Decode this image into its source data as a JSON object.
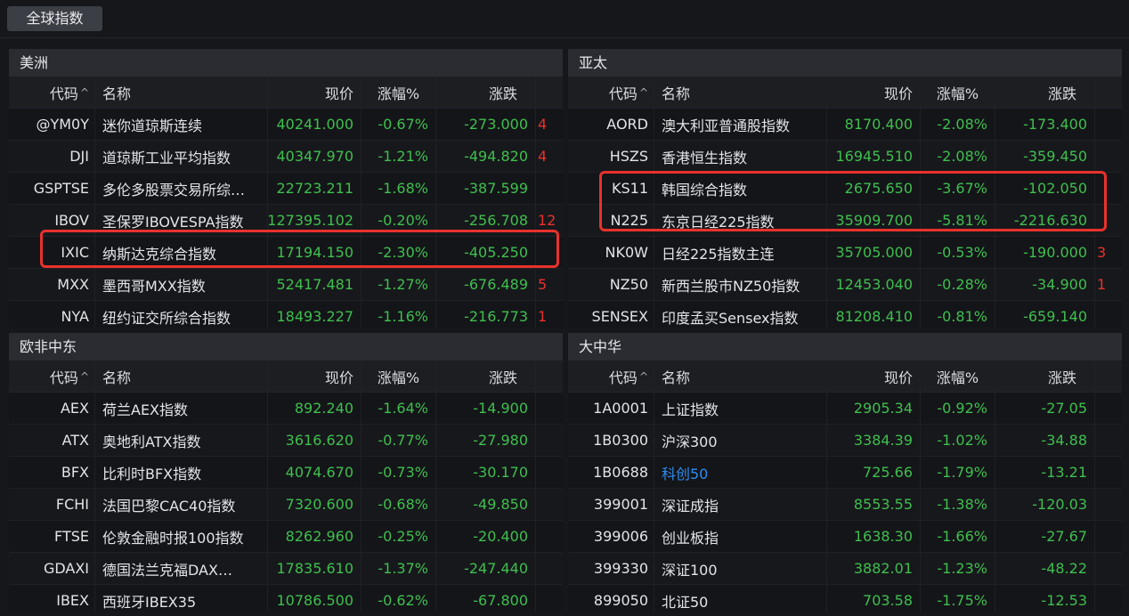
{
  "header": {
    "tab_label": "全球指数"
  },
  "columns": {
    "code": "代码",
    "name": "名称",
    "price": "现价",
    "pct": "涨幅%",
    "change": "涨跌",
    "sort_icon": "chevron-up-icon"
  },
  "colors": {
    "green": "#3fbf4e",
    "red": "#e8322c",
    "blue": "#2d8cf0"
  },
  "panels": {
    "americas": {
      "title": "美洲",
      "rows": [
        {
          "code": "@YM0Y",
          "name": "迷你道琼斯连续",
          "price": "40241.000",
          "pct": "-0.67%",
          "change": "-273.000",
          "extra": "4"
        },
        {
          "code": "DJI",
          "name": "道琼斯工业平均指数",
          "price": "40347.970",
          "pct": "-1.21%",
          "change": "-494.820",
          "extra": "4"
        },
        {
          "code": "GSPTSE",
          "name": "多伦多股票交易所综…",
          "price": "22723.211",
          "pct": "-1.68%",
          "change": "-387.599",
          "extra": ""
        },
        {
          "code": "IBOV",
          "name": "圣保罗IBOVESPA指数",
          "price": "127395.102",
          "pct": "-0.20%",
          "change": "-256.708",
          "extra": "12"
        },
        {
          "code": "IXIC",
          "name": "纳斯达克综合指数",
          "price": "17194.150",
          "pct": "-2.30%",
          "change": "-405.250",
          "extra": ""
        },
        {
          "code": "MXX",
          "name": "墨西哥MXX指数",
          "price": "52417.481",
          "pct": "-1.27%",
          "change": "-676.489",
          "extra": "5"
        },
        {
          "code": "NYA",
          "name": "纽约证交所综合指数",
          "price": "18493.227",
          "pct": "-1.16%",
          "change": "-216.773",
          "extra": "1"
        }
      ]
    },
    "asia_pacific": {
      "title": "亚太",
      "rows": [
        {
          "code": "AORD",
          "name": "澳大利亚普通股指数",
          "price": "8170.400",
          "pct": "-2.08%",
          "change": "-173.400",
          "extra": ""
        },
        {
          "code": "HSZS",
          "name": "香港恒生指数",
          "price": "16945.510",
          "pct": "-2.08%",
          "change": "-359.450",
          "extra": ""
        },
        {
          "code": "KS11",
          "name": "韩国综合指数",
          "price": "2675.650",
          "pct": "-3.67%",
          "change": "-102.050",
          "extra": ""
        },
        {
          "code": "N225",
          "name": "东京日经225指数",
          "price": "35909.700",
          "pct": "-5.81%",
          "change": "-2216.630",
          "extra": ""
        },
        {
          "code": "NK0W",
          "name": "日经225指数主连",
          "price": "35705.000",
          "pct": "-0.53%",
          "change": "-190.000",
          "extra": "3"
        },
        {
          "code": "NZ50",
          "name": "新西兰股市NZ50指数",
          "price": "12453.040",
          "pct": "-0.28%",
          "change": "-34.900",
          "extra": "1"
        },
        {
          "code": "SENSEX",
          "name": "印度孟买Sensex指数",
          "price": "81208.410",
          "pct": "-0.81%",
          "change": "-659.140",
          "extra": ""
        }
      ]
    },
    "emea": {
      "title": "欧非中东",
      "rows": [
        {
          "code": "AEX",
          "name": "荷兰AEX指数",
          "price": "892.240",
          "pct": "-1.64%",
          "change": "-14.900",
          "extra": ""
        },
        {
          "code": "ATX",
          "name": "奥地利ATX指数",
          "price": "3616.620",
          "pct": "-0.77%",
          "change": "-27.980",
          "extra": ""
        },
        {
          "code": "BFX",
          "name": "比利时BFX指数",
          "price": "4074.670",
          "pct": "-0.73%",
          "change": "-30.170",
          "extra": ""
        },
        {
          "code": "FCHI",
          "name": "法国巴黎CAC40指数",
          "price": "7320.600",
          "pct": "-0.68%",
          "change": "-49.850",
          "extra": ""
        },
        {
          "code": "FTSE",
          "name": "伦敦金融时报100指数",
          "price": "8262.960",
          "pct": "-0.25%",
          "change": "-20.400",
          "extra": ""
        },
        {
          "code": "GDAXI",
          "name": "德国法兰克福DAX…",
          "price": "17835.610",
          "pct": "-1.37%",
          "change": "-247.440",
          "extra": ""
        },
        {
          "code": "IBEX",
          "name": "西班牙IBEX35",
          "price": "10786.500",
          "pct": "-0.62%",
          "change": "-67.800",
          "extra": ""
        }
      ]
    },
    "greater_china": {
      "title": "大中华",
      "rows": [
        {
          "code": "1A0001",
          "name": "上证指数",
          "price": "2905.34",
          "pct": "-0.92%",
          "change": "-27.05",
          "extra": ""
        },
        {
          "code": "1B0300",
          "name": "沪深300",
          "price": "3384.39",
          "pct": "-1.02%",
          "change": "-34.88",
          "extra": ""
        },
        {
          "code": "1B0688",
          "name": "科创50",
          "price": "725.66",
          "pct": "-1.79%",
          "change": "-13.21",
          "extra": ""
        },
        {
          "code": "399001",
          "name": "深证成指",
          "price": "8553.55",
          "pct": "-1.38%",
          "change": "-120.03",
          "extra": ""
        },
        {
          "code": "399006",
          "name": "创业板指",
          "price": "1638.30",
          "pct": "-1.66%",
          "change": "-27.67",
          "extra": ""
        },
        {
          "code": "399330",
          "name": "深证100",
          "price": "3882.01",
          "pct": "-1.23%",
          "change": "-48.22",
          "extra": ""
        },
        {
          "code": "899050",
          "name": "北证50",
          "price": "703.58",
          "pct": "-1.75%",
          "change": "-12.53",
          "extra": ""
        }
      ]
    }
  }
}
